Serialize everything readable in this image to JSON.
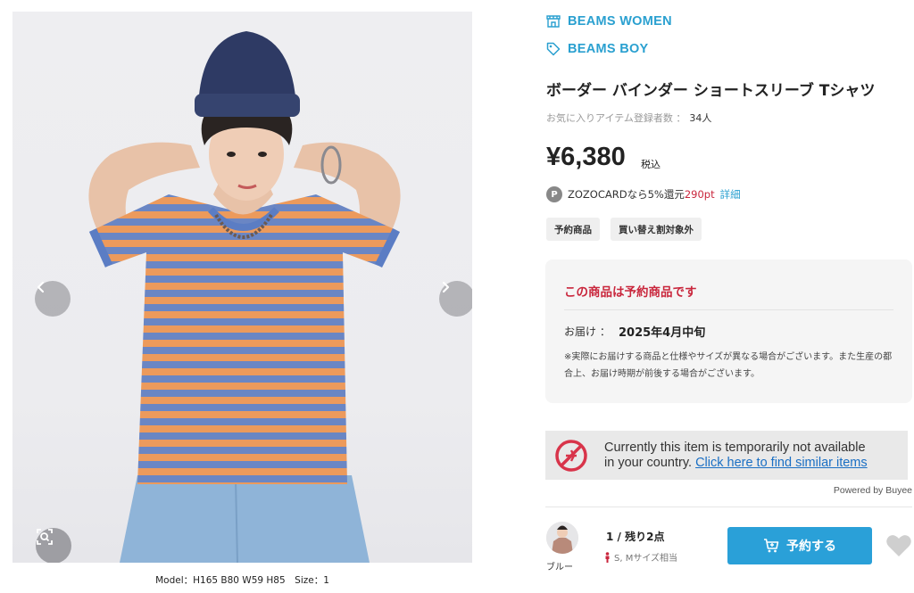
{
  "brands": [
    {
      "label": "BEAMS WOMEN",
      "icon": "store-icon"
    },
    {
      "label": "BEAMS BOY",
      "icon": "tag-icon"
    }
  ],
  "product": {
    "title": "ボーダー バインダー ショートスリーブ Tシャツ",
    "favorite_label": "お気に入りアイテム登録者数 ：",
    "favorite_count": "34人",
    "price": "¥6,380",
    "tax_label": "税込",
    "image_caption": "Model：H165 B80 W59 H85　Size：1"
  },
  "zozocard": {
    "icon": "P",
    "text": "ZOZOCARDなら5%還元",
    "points": "290pt",
    "detail_link": "詳細"
  },
  "tags": [
    "予約商品",
    "買い替え割対象外"
  ],
  "notice": {
    "heading": "この商品は予約商品です",
    "delivery_label": "お届け ：",
    "delivery_value": "2025年4月中旬",
    "note": "※実際にお届けする商品と仕様やサイズが異なる場合がございます。また生産の都合上、お届け時期が前後する場合がございます。"
  },
  "buyee": {
    "line1": "Currently this item is temporarily not available",
    "line2": "in your country.",
    "link": "Click here to find similar items",
    "powered_by": "Powered by Buyee"
  },
  "variant": {
    "color_name": "ブルー",
    "stock": "1 / 残り2点",
    "sizes": "S, Mサイズ相当",
    "buy_label": "予約する"
  },
  "colors": {
    "brand_blue": "#2aa0d0",
    "button_blue": "#2aa0d8",
    "alert_red": "#c9263c",
    "stripe_orange": "#ec9a5c",
    "stripe_blue": "#6a86c4"
  }
}
